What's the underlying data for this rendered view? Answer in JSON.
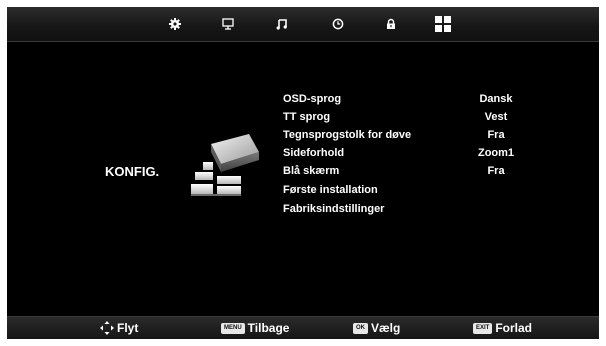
{
  "colors": {
    "background": "#000000",
    "text": "#ffffff",
    "bar": "#1e1e1e"
  },
  "tabs": [
    {
      "name": "settings-tab",
      "icon": "gear-icon"
    },
    {
      "name": "picture-tab",
      "icon": "monitor-icon"
    },
    {
      "name": "sound-tab",
      "icon": "music-note-icon"
    },
    {
      "name": "timer-tab",
      "icon": "clock-icon"
    },
    {
      "name": "lock-tab",
      "icon": "lock-icon"
    },
    {
      "name": "setup-tab",
      "icon": "grid-icon"
    }
  ],
  "section": {
    "title": "KONFIG."
  },
  "menu": [
    {
      "label": "OSD-sprog",
      "value": "Dansk"
    },
    {
      "label": "TT sprog",
      "value": "Vest"
    },
    {
      "label": "Tegnsprogstolk for døve",
      "value": "Fra"
    },
    {
      "label": "Sideforhold",
      "value": "Zoom1"
    },
    {
      "label": "Blå skærm",
      "value": "Fra"
    },
    {
      "label": "Første installation",
      "value": ""
    },
    {
      "label": "Fabriksindstillinger",
      "value": ""
    }
  ],
  "hints": {
    "move": {
      "icon": "dpad-icon",
      "label": "Flyt"
    },
    "back": {
      "key": "MENU",
      "label": "Tilbage"
    },
    "select": {
      "key": "OK",
      "label": "Vælg"
    },
    "exit": {
      "key": "EXIT",
      "label": "Forlad"
    }
  }
}
